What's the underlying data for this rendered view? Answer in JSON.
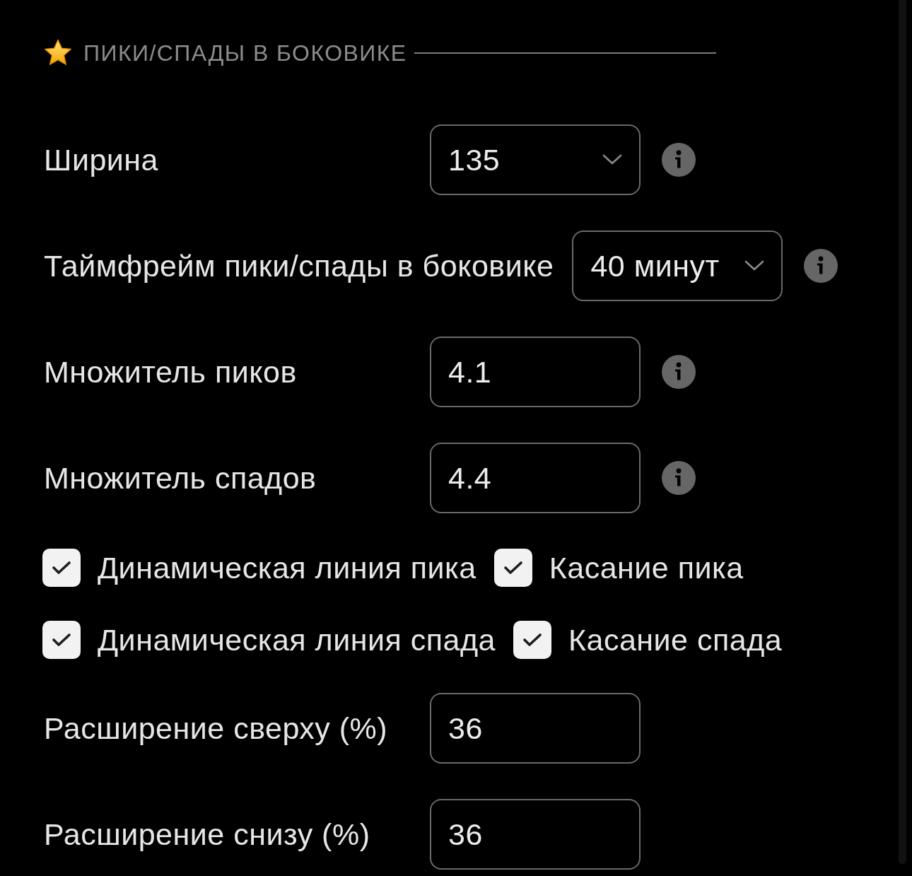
{
  "section": {
    "title": "ПИКИ/СПАДЫ В БОКОВИКЕ"
  },
  "rows": [
    {
      "kind": "select",
      "label": "Ширина",
      "value": "135",
      "info": true
    },
    {
      "kind": "select",
      "label": "Таймфрейм пики/спады в боковике",
      "value": "40 минут",
      "info": true
    },
    {
      "kind": "input",
      "label": "Множитель пиков",
      "value": "4.1",
      "info": true
    },
    {
      "kind": "input",
      "label": "Множитель спадов",
      "value": "4.4",
      "info": true
    },
    {
      "kind": "checkboxes",
      "items": [
        {
          "label": "Динамическая линия пика",
          "checked": true
        },
        {
          "label": "Касание пика",
          "checked": true
        }
      ]
    },
    {
      "kind": "checkboxes",
      "items": [
        {
          "label": "Динамическая линия спада",
          "checked": true
        },
        {
          "label": "Касание спада",
          "checked": true
        }
      ]
    },
    {
      "kind": "input",
      "label": "Расширение сверху (%)",
      "value": "36",
      "info": false
    },
    {
      "kind": "input",
      "label": "Расширение снизу (%)",
      "value": "36",
      "info": false
    }
  ]
}
